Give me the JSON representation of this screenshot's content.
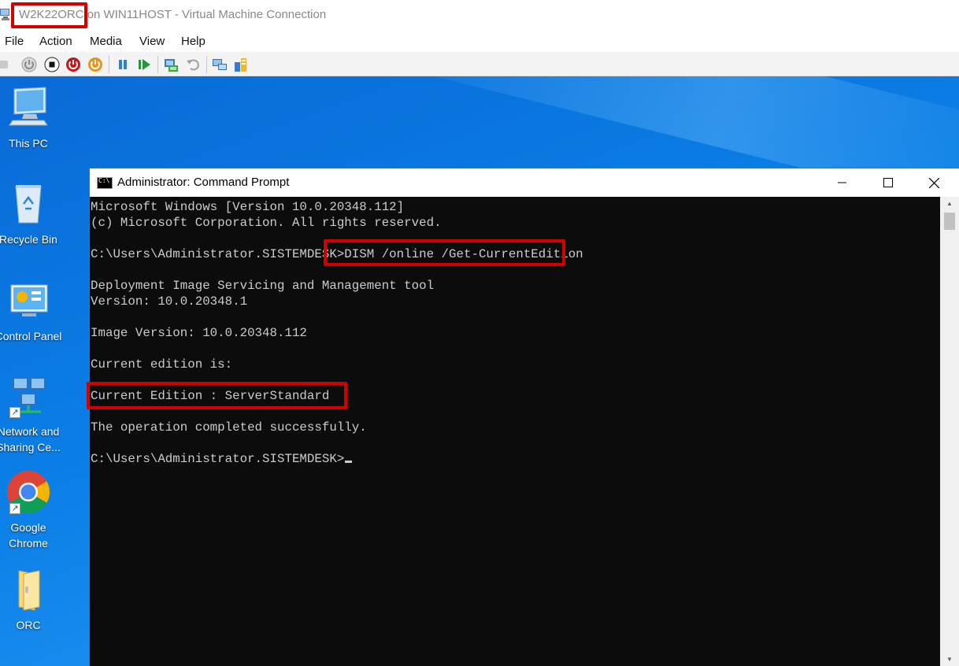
{
  "vm_window": {
    "title": "W2K22ORC on WIN11HOST - Virtual Machine Connection",
    "menu": [
      "File",
      "Action",
      "Media",
      "View",
      "Help"
    ],
    "toolbar": [
      "ctrl-alt-del-icon",
      "start-icon",
      "turn-off-icon",
      "shut-down-icon",
      "save-icon",
      "pause-icon",
      "resume-icon",
      "checkpoint-icon",
      "revert-icon",
      "enhanced-session-icon",
      "share-icon"
    ],
    "highlight_color": "#d40000"
  },
  "desktop": {
    "icons": [
      {
        "label": "This PC"
      },
      {
        "label": "Recycle Bin"
      },
      {
        "label": "Control Panel"
      },
      {
        "label": "Network and Sharing Ce..."
      },
      {
        "label": "Google Chrome"
      },
      {
        "label": "ORC"
      }
    ]
  },
  "cmd": {
    "title": "Administrator: Command Prompt",
    "lines": [
      "Microsoft Windows [Version 10.0.20348.112]",
      "(c) Microsoft Corporation. All rights reserved.",
      "",
      "C:\\Users\\Administrator.SISTEMDESK>DISM /online /Get-CurrentEdition",
      "",
      "Deployment Image Servicing and Management tool",
      "Version: 10.0.20348.1",
      "",
      "Image Version: 10.0.20348.112",
      "",
      "Current edition is:",
      "",
      "Current Edition : ServerStandard",
      "",
      "The operation completed successfully.",
      "",
      "C:\\Users\\Administrator.SISTEMDESK>"
    ],
    "colors": {
      "background": "#0c0c0c",
      "text": "#cccccc"
    }
  }
}
